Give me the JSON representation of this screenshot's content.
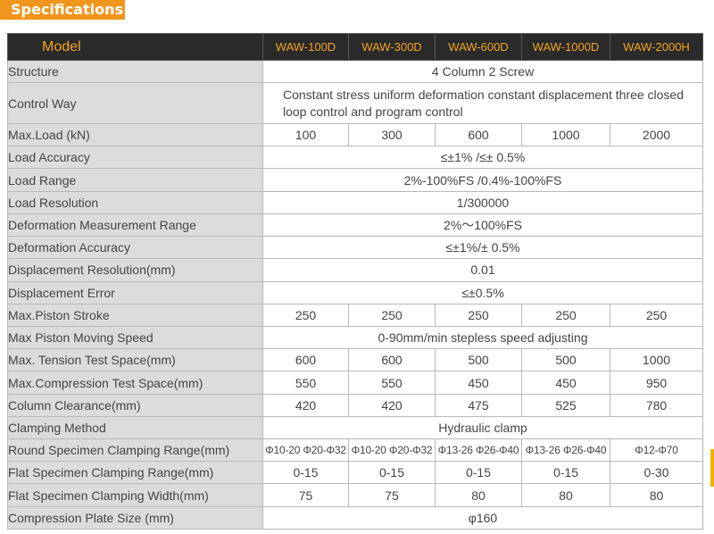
{
  "header": {
    "title": "Specifications:"
  },
  "colors": {
    "accent": "#f0951e",
    "header_bg": "#2a2a2a",
    "header_text": "#f6a51e",
    "label_bg": "#dcdcdc"
  },
  "table": {
    "headers": [
      "Model",
      "WAW-100D",
      "WAW-300D",
      "WAW-600D",
      "WAW-1000D",
      "WAW-2000H"
    ],
    "rows": [
      {
        "label": "Structure",
        "span": true,
        "value": "4 Column 2 Screw"
      },
      {
        "label": "Control Way",
        "span": true,
        "tall": true,
        "value": "Constant stress uniform deformation constant displacement three closed loop control and program control"
      },
      {
        "label": "Max.Load (kN)",
        "values": [
          "100",
          "300",
          "600",
          "1000",
          "2000"
        ]
      },
      {
        "label": "Load Accuracy",
        "span": true,
        "value": "≤±1% /≤± 0.5%"
      },
      {
        "label": "Load Range",
        "span": true,
        "value": "2%-100%FS /0.4%-100%FS"
      },
      {
        "label": "Load Resolution",
        "span": true,
        "value": "1/300000"
      },
      {
        "label": "Deformation Measurement Range",
        "span": true,
        "value": "2%～100%FS"
      },
      {
        "label": "Deformation Accuracy",
        "span": true,
        "value": "≤±1%/± 0.5%"
      },
      {
        "label": "Displacement Resolution(mm)",
        "span": true,
        "value": "0.01"
      },
      {
        "label": "Displacement Error",
        "span": true,
        "value": "≤±0.5%"
      },
      {
        "label": "Max.Piston Stroke",
        "values": [
          "250",
          "250",
          "250",
          "250",
          "250"
        ]
      },
      {
        "label": "Max Piston Moving Speed",
        "span": true,
        "value": "0-90mm/min stepless speed adjusting"
      },
      {
        "label": "Max. Tension Test Space(mm)",
        "values": [
          "600",
          "600",
          "500",
          "500",
          "1000"
        ]
      },
      {
        "label": "Max.Compression Test Space(mm)",
        "values": [
          "550",
          "550",
          "450",
          "450",
          "950"
        ]
      },
      {
        "label": "Column Clearance(mm)",
        "values": [
          "420",
          "420",
          "475",
          "525",
          "780"
        ]
      },
      {
        "label": "Clamping Method",
        "span": true,
        "value": "Hydraulic clamp"
      },
      {
        "label": "Round Specimen Clamping Range(mm)",
        "small": true,
        "values": [
          "Φ10-20 Φ20-Φ32",
          "Φ10-20 Φ20-Φ32",
          "Φ13-26 Φ26-Φ40",
          "Φ13-26 Φ26-Φ40",
          "Φ12-Φ70"
        ]
      },
      {
        "label": "Flat Specimen Clamping Range(mm)",
        "values": [
          "0-15",
          "0-15",
          "0-15",
          "0-15",
          "0-30"
        ]
      },
      {
        "label": "Flat Specimen Clamping Width(mm)",
        "values": [
          "75",
          "75",
          "80",
          "80",
          "80"
        ]
      },
      {
        "label": "Compression Plate Size (mm)",
        "span": true,
        "value": "φ160"
      }
    ]
  }
}
